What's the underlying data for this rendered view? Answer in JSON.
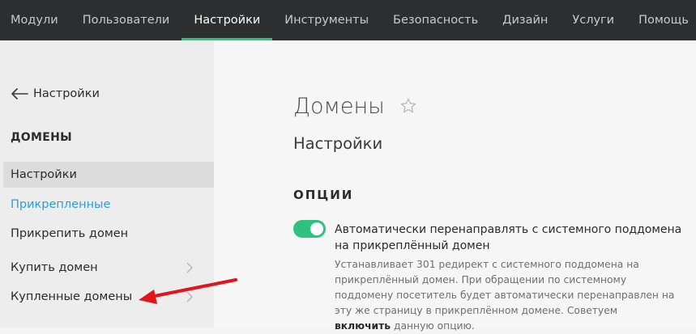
{
  "topnav": {
    "items": [
      {
        "label": "Модули"
      },
      {
        "label": "Пользователи"
      },
      {
        "label": "Настройки"
      },
      {
        "label": "Инструменты"
      },
      {
        "label": "Безопасность"
      },
      {
        "label": "Дизайн"
      },
      {
        "label": "Услуги"
      },
      {
        "label": "Помощь"
      }
    ],
    "active": "Настройки"
  },
  "sidebar": {
    "back_label": "Настройки",
    "section_title": "ДОМЕНЫ",
    "items": [
      {
        "label": "Настройки"
      },
      {
        "label": "Прикрепленные"
      },
      {
        "label": "Прикрепить домен"
      },
      {
        "label": "Купить домен"
      },
      {
        "label": "Купленные домены"
      }
    ]
  },
  "main": {
    "title": "Домены",
    "subtitle": "Настройки",
    "options_heading": "ОПЦИИ",
    "option": {
      "enabled": true,
      "label": "Автоматически перенаправлять с системного поддомена на прикреплённый домен",
      "desc_before": "Устанавливает 301 редирект с системного поддомена на прикреплённый домен. При обращении по системному поддомену посетитель будет автоматически перенаправлен на эту же страницу в прикреплённом домене. Советуем ",
      "desc_bold": "включить",
      "desc_after": " данную опцию."
    }
  },
  "colors": {
    "nav_bg": "#2d2e30",
    "accent_green": "#2ec27e",
    "link_blue": "#2e9fd6",
    "arrow_red": "#e0161b"
  }
}
